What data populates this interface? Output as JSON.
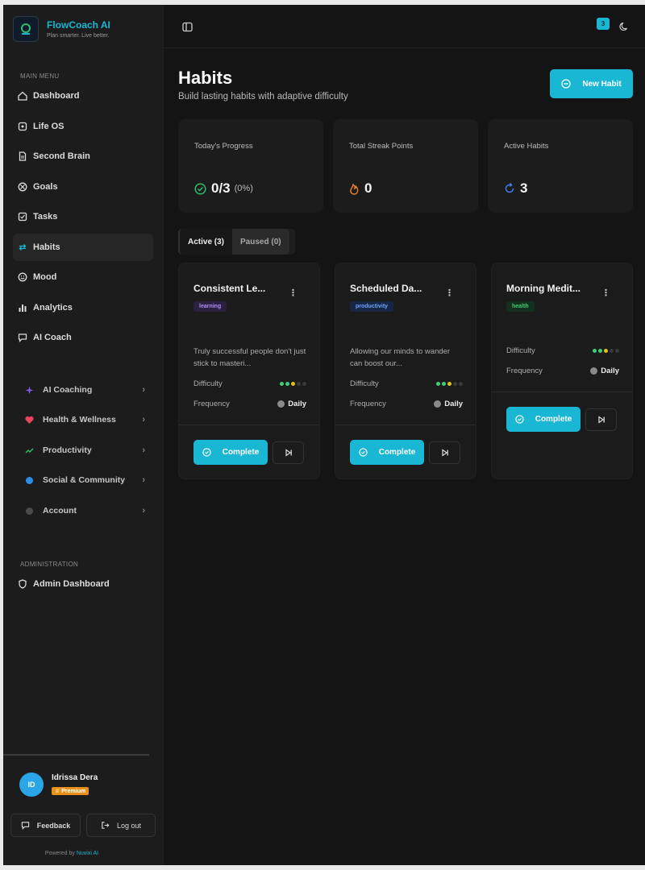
{
  "brand": {
    "name": "FlowCoach AI",
    "tagline": "Plan smarter. Live better."
  },
  "sidebar": {
    "main_menu_label": "MAIN MENU",
    "items": [
      {
        "label": "Dashboard",
        "icon": "home-icon"
      },
      {
        "label": "Life OS",
        "icon": "grid-icon"
      },
      {
        "label": "Second Brain",
        "icon": "document-icon"
      },
      {
        "label": "Goals",
        "icon": "target-icon"
      },
      {
        "label": "Tasks",
        "icon": "checkbox-icon"
      },
      {
        "label": "Habits",
        "icon": "repeat-icon",
        "active": true
      },
      {
        "label": "Mood",
        "icon": "smile-icon"
      },
      {
        "label": "Analytics",
        "icon": "bar-chart-icon"
      },
      {
        "label": "AI Coach",
        "icon": "chat-icon"
      }
    ],
    "groups": [
      {
        "label": "AI Coaching",
        "color": "#8a5cf2"
      },
      {
        "label": "Health & Wellness",
        "color": "#e8445a"
      },
      {
        "label": "Productivity",
        "color": "#2bbf6a"
      },
      {
        "label": "Social & Community",
        "color": "#2a8fe8"
      },
      {
        "label": "Account",
        "color": "#5a5a5a"
      }
    ],
    "admin_label": "ADMINISTRATION",
    "admin_item": "Admin Dashboard"
  },
  "user": {
    "initials": "ID",
    "name": "Idrissa Dera",
    "badge": "Premium"
  },
  "footer": {
    "feedback": "Feedback",
    "logout": "Log out",
    "powered_prefix": "Powered by",
    "powered_brand": "Nuvixi AI"
  },
  "topbar": {
    "notification_count": "3"
  },
  "page": {
    "title": "Habits",
    "subtitle": "Build lasting habits with adaptive difficulty",
    "new_habit": "New Habit"
  },
  "stats": {
    "progress_label": "Today's Progress",
    "progress_value": "0/3",
    "progress_pct": "(0%)",
    "streak_label": "Total Streak Points",
    "streak_value": "0",
    "active_label": "Active Habits",
    "active_value": "3"
  },
  "tabs": {
    "active": "Active (3)",
    "paused": "Paused (0)"
  },
  "labels": {
    "difficulty": "Difficulty",
    "frequency": "Frequency",
    "complete": "Complete"
  },
  "habits": [
    {
      "title": "Consistent Le...",
      "tag": "learning",
      "desc": "Truly successful people don't just stick to masteri...",
      "difficulty": 3,
      "frequency": "Daily"
    },
    {
      "title": "Scheduled Da...",
      "tag": "productivity",
      "desc": "Allowing our minds to wander can boost our...",
      "difficulty": 3,
      "frequency": "Daily"
    },
    {
      "title": "Morning Medit...",
      "tag": "health",
      "desc": "",
      "difficulty": 3,
      "frequency": "Daily"
    }
  ],
  "colors": {
    "accent": "#19b7d4",
    "background": "#141414",
    "sidebar": "#1c1c1c"
  }
}
